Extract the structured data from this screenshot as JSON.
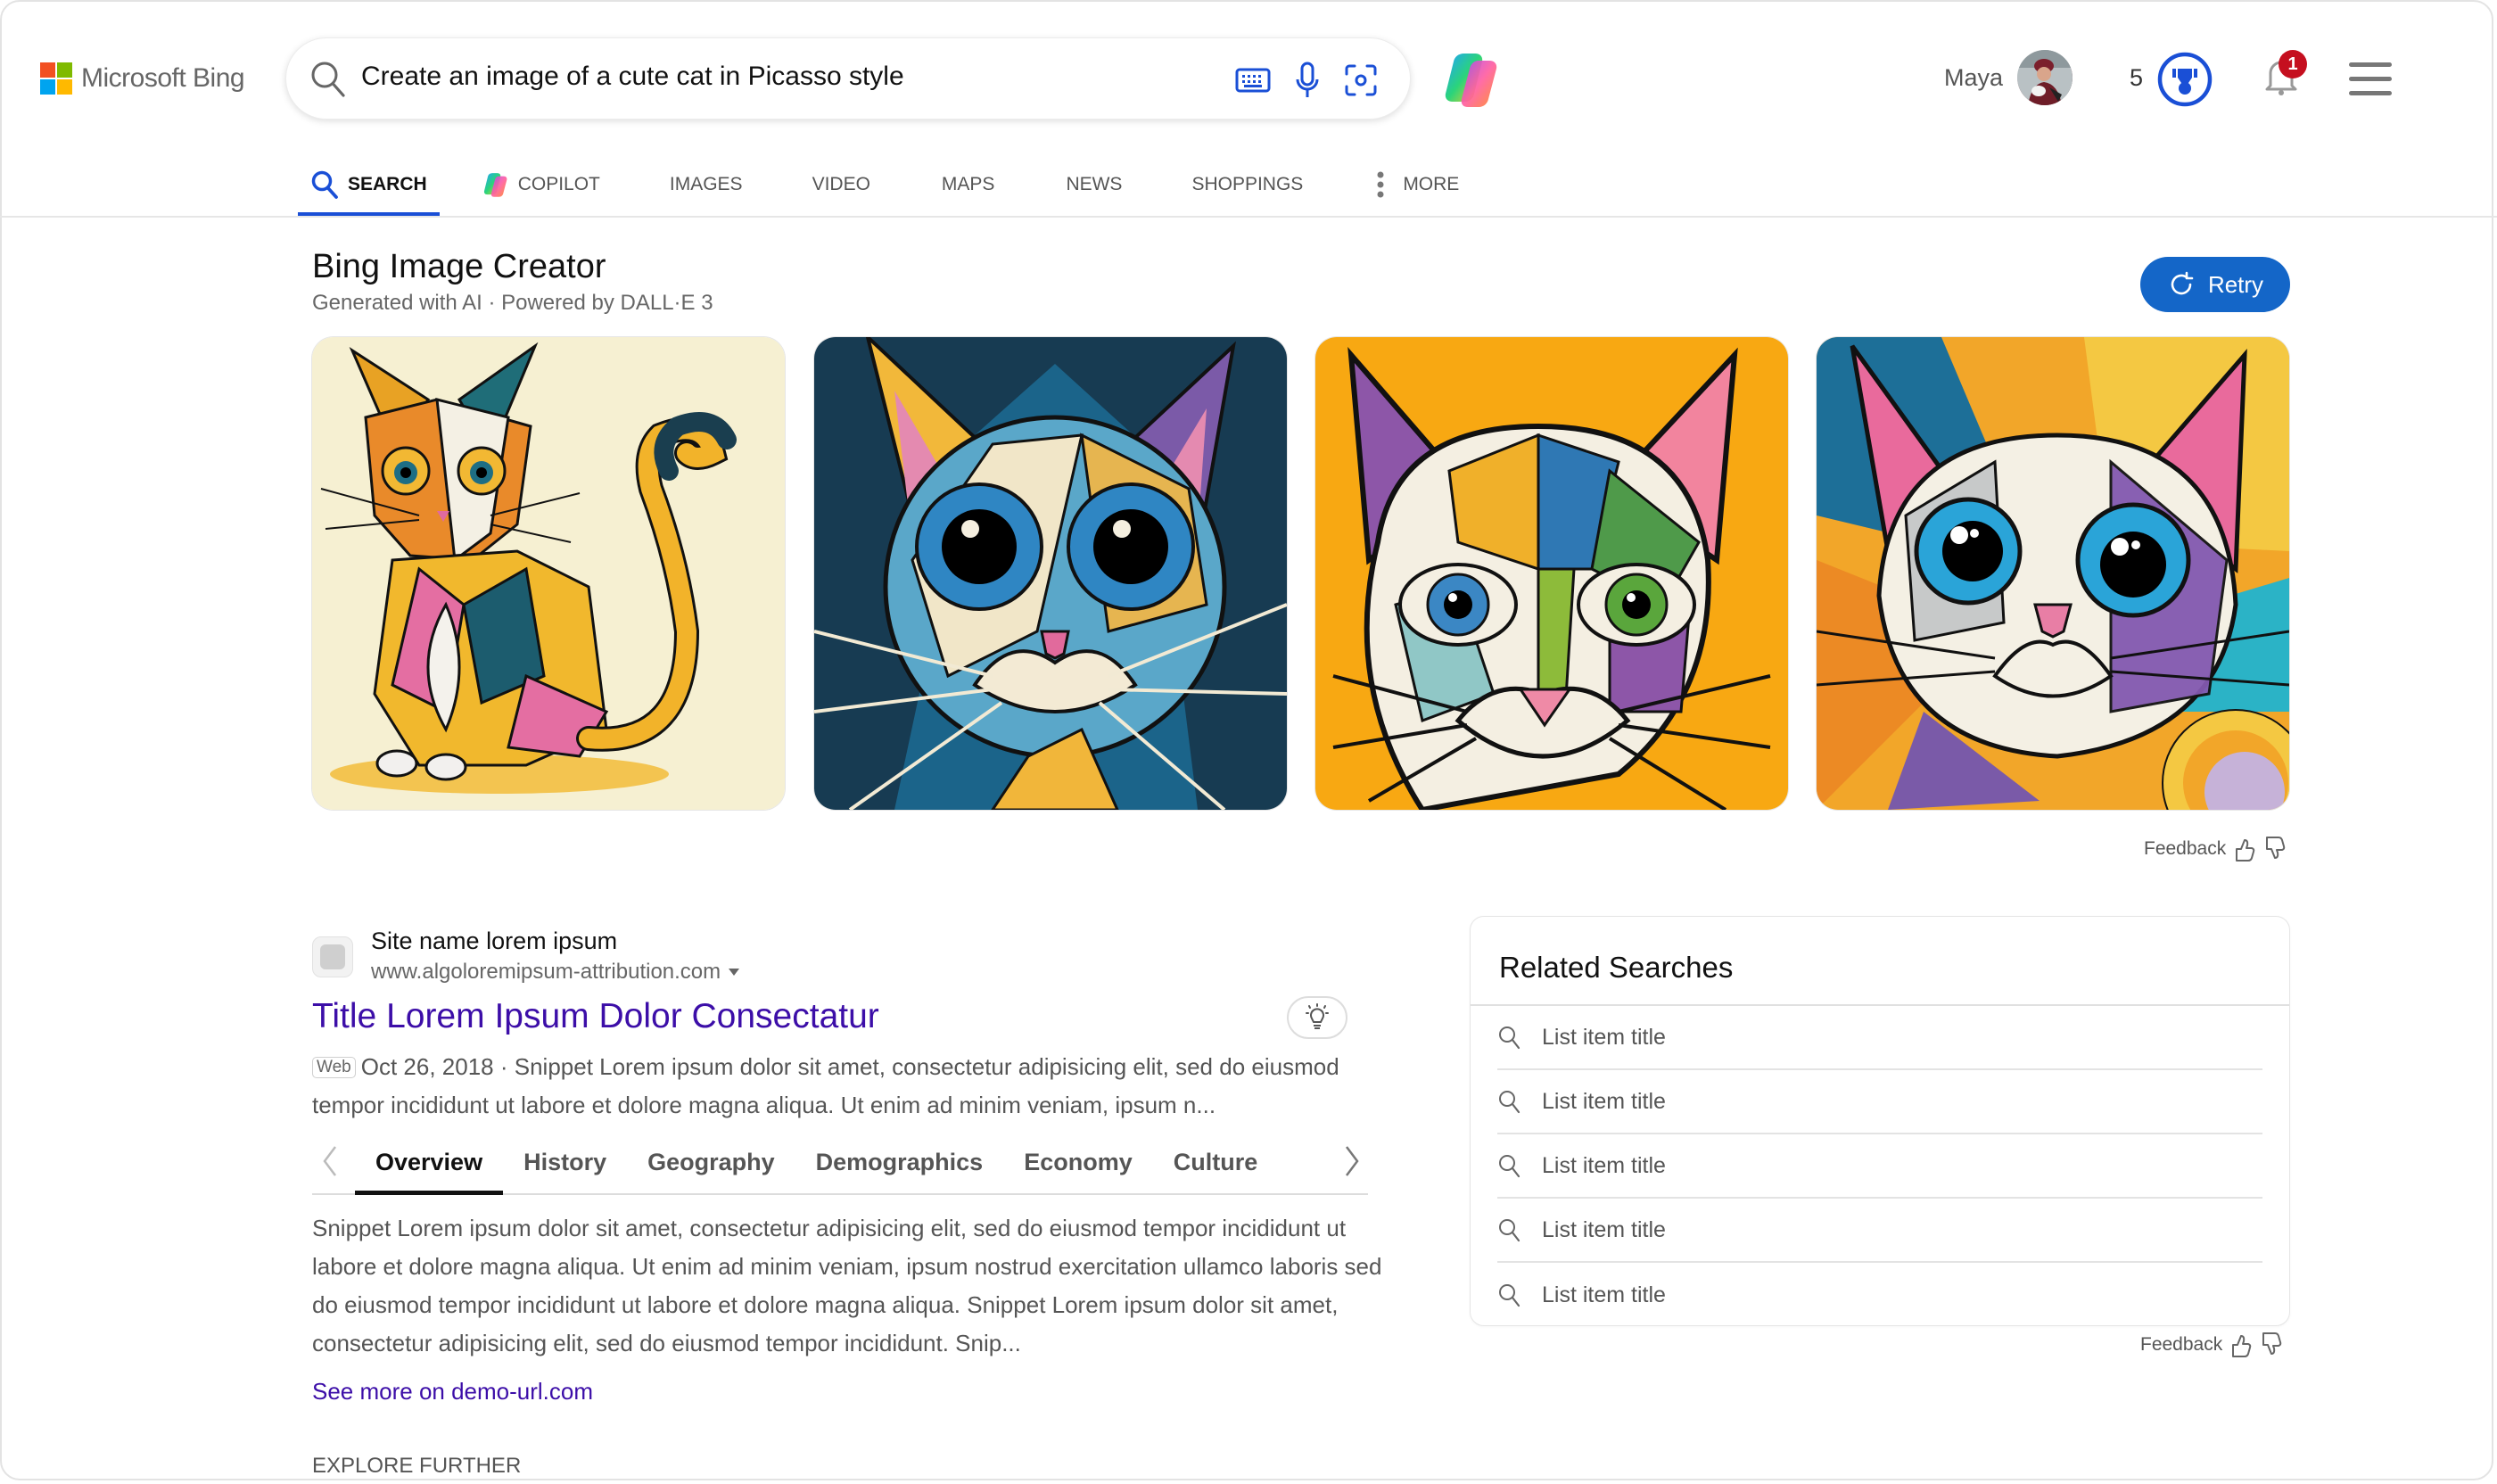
{
  "header": {
    "logo_text": "Microsoft Bing",
    "logo_colors": [
      "#f25022",
      "#7fba00",
      "#00a4ef",
      "#ffb900"
    ],
    "search": {
      "query": "Create an image of a cute cat in Picasso style",
      "icons": [
        "search-icon",
        "keyboard-icon",
        "microphone-icon",
        "visual-search-icon"
      ]
    },
    "user_name": "Maya",
    "rewards_points": "5",
    "notification_count": "1",
    "accent_color": "#1a4fd6"
  },
  "nav": {
    "items": [
      {
        "label": "SEARCH",
        "icon": "search-icon",
        "active": true
      },
      {
        "label": "COPILOT",
        "icon": "copilot-icon",
        "active": false
      },
      {
        "label": "IMAGES",
        "active": false
      },
      {
        "label": "VIDEO",
        "active": false
      },
      {
        "label": "MAPS",
        "active": false
      },
      {
        "label": "NEWS",
        "active": false
      },
      {
        "label": "SHOPPINGS",
        "active": false
      },
      {
        "label": "MORE",
        "icon": "more-vertical-icon",
        "active": false
      }
    ]
  },
  "image_creator": {
    "title": "Bing Image Creator",
    "subtitle": "Generated with AI · Powered by DALL·E 3",
    "retry_label": "Retry",
    "retry_color": "#1466c8",
    "images": [
      {
        "alt": "Cubist cat sitting on cream background",
        "background": "#f6f0d2"
      },
      {
        "alt": "Cubist cat face with big blue eyes on dark teal background",
        "background": "#173b52"
      },
      {
        "alt": "Cubist cat face with blue and green eyes on orange background",
        "background": "#f8a812"
      },
      {
        "alt": "Cubist cat face with blue eyes on multicolor background",
        "background": "#f2a629"
      }
    ],
    "feedback_label": "Feedback"
  },
  "result": {
    "site_name": "Site name lorem ipsum",
    "site_url": "www.algoloremipsum-attribution.com",
    "title": "Title Lorem Ipsum Dolor Consectatur",
    "web_tag": "Web",
    "date": "Oct 26, 2018",
    "snippet": "Snippet Lorem ipsum dolor sit amet, consectetur adipisicing elit, sed do eiusmod tempor incididunt ut labore et dolore magna aliqua. Ut enim ad minim veniam, ipsum n...",
    "tabs": [
      {
        "label": "Overview",
        "active": true
      },
      {
        "label": "History",
        "active": false
      },
      {
        "label": "Geography",
        "active": false
      },
      {
        "label": "Demographics",
        "active": false
      },
      {
        "label": "Economy",
        "active": false
      },
      {
        "label": "Culture",
        "active": false
      }
    ],
    "tab_snippet": "Snippet Lorem ipsum dolor sit amet, consectetur adipisicing elit, sed do eiusmod tempor incididunt ut labore et dolore magna aliqua. Ut enim ad minim veniam, ipsum nostrud exercitation ullamco laboris sed do eiusmod tempor incididunt ut labore et dolore magna aliqua. Snippet Lorem ipsum dolor sit amet, consectetur adipisicing elit, sed do eiusmod tempor incididunt. Snip...",
    "see_more": "See more on demo-url.com",
    "link_color": "#3c0ea8"
  },
  "explore_further": "EXPLORE FURTHER",
  "related": {
    "title": "Related Searches",
    "items": [
      "List item title",
      "List item title",
      "List item title",
      "List item title",
      "List item title"
    ],
    "feedback_label": "Feedback"
  }
}
